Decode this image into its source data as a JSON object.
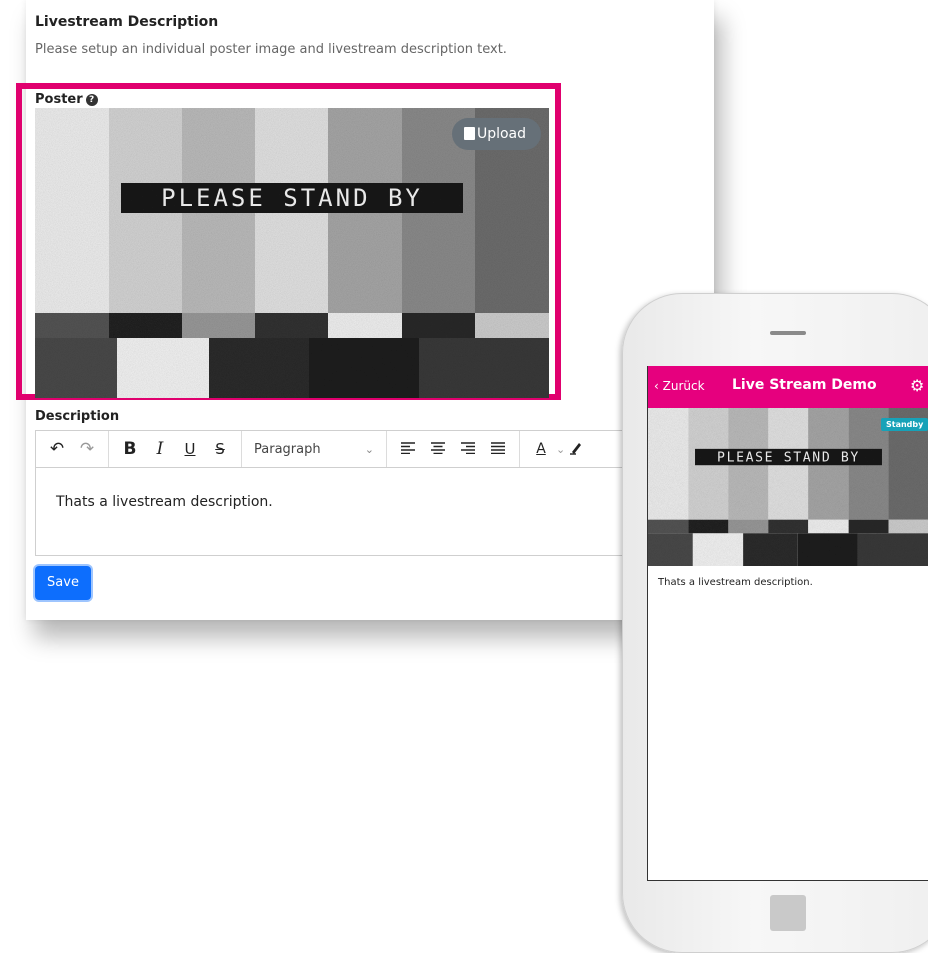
{
  "section": {
    "title": "Livestream Description",
    "subtitle": "Please setup an individual poster image and livestream description text."
  },
  "poster": {
    "label": "Poster",
    "help_icon": "question-circle-icon",
    "upload_label": "Upload",
    "image_text": "PLEASE STAND BY"
  },
  "description": {
    "label": "Description",
    "format_select": "Paragraph",
    "text": "Thats a livestream description."
  },
  "toolbar": {
    "undo": "↶",
    "redo": "↷",
    "bold": "B",
    "italic": "I",
    "underline": "U",
    "strike": "S",
    "font_color": "A"
  },
  "save_label": "Save",
  "phone": {
    "back_label": "Zurück",
    "title": "Live Stream Demo",
    "badge": "Standby",
    "image_text": "PLEASE STAND BY",
    "description": "Thats a livestream description."
  },
  "colors": {
    "accent_magenta": "#e0006e",
    "header_magenta": "#e6007e",
    "save_blue": "#0d6efd",
    "badge_teal": "#17a2b8"
  }
}
